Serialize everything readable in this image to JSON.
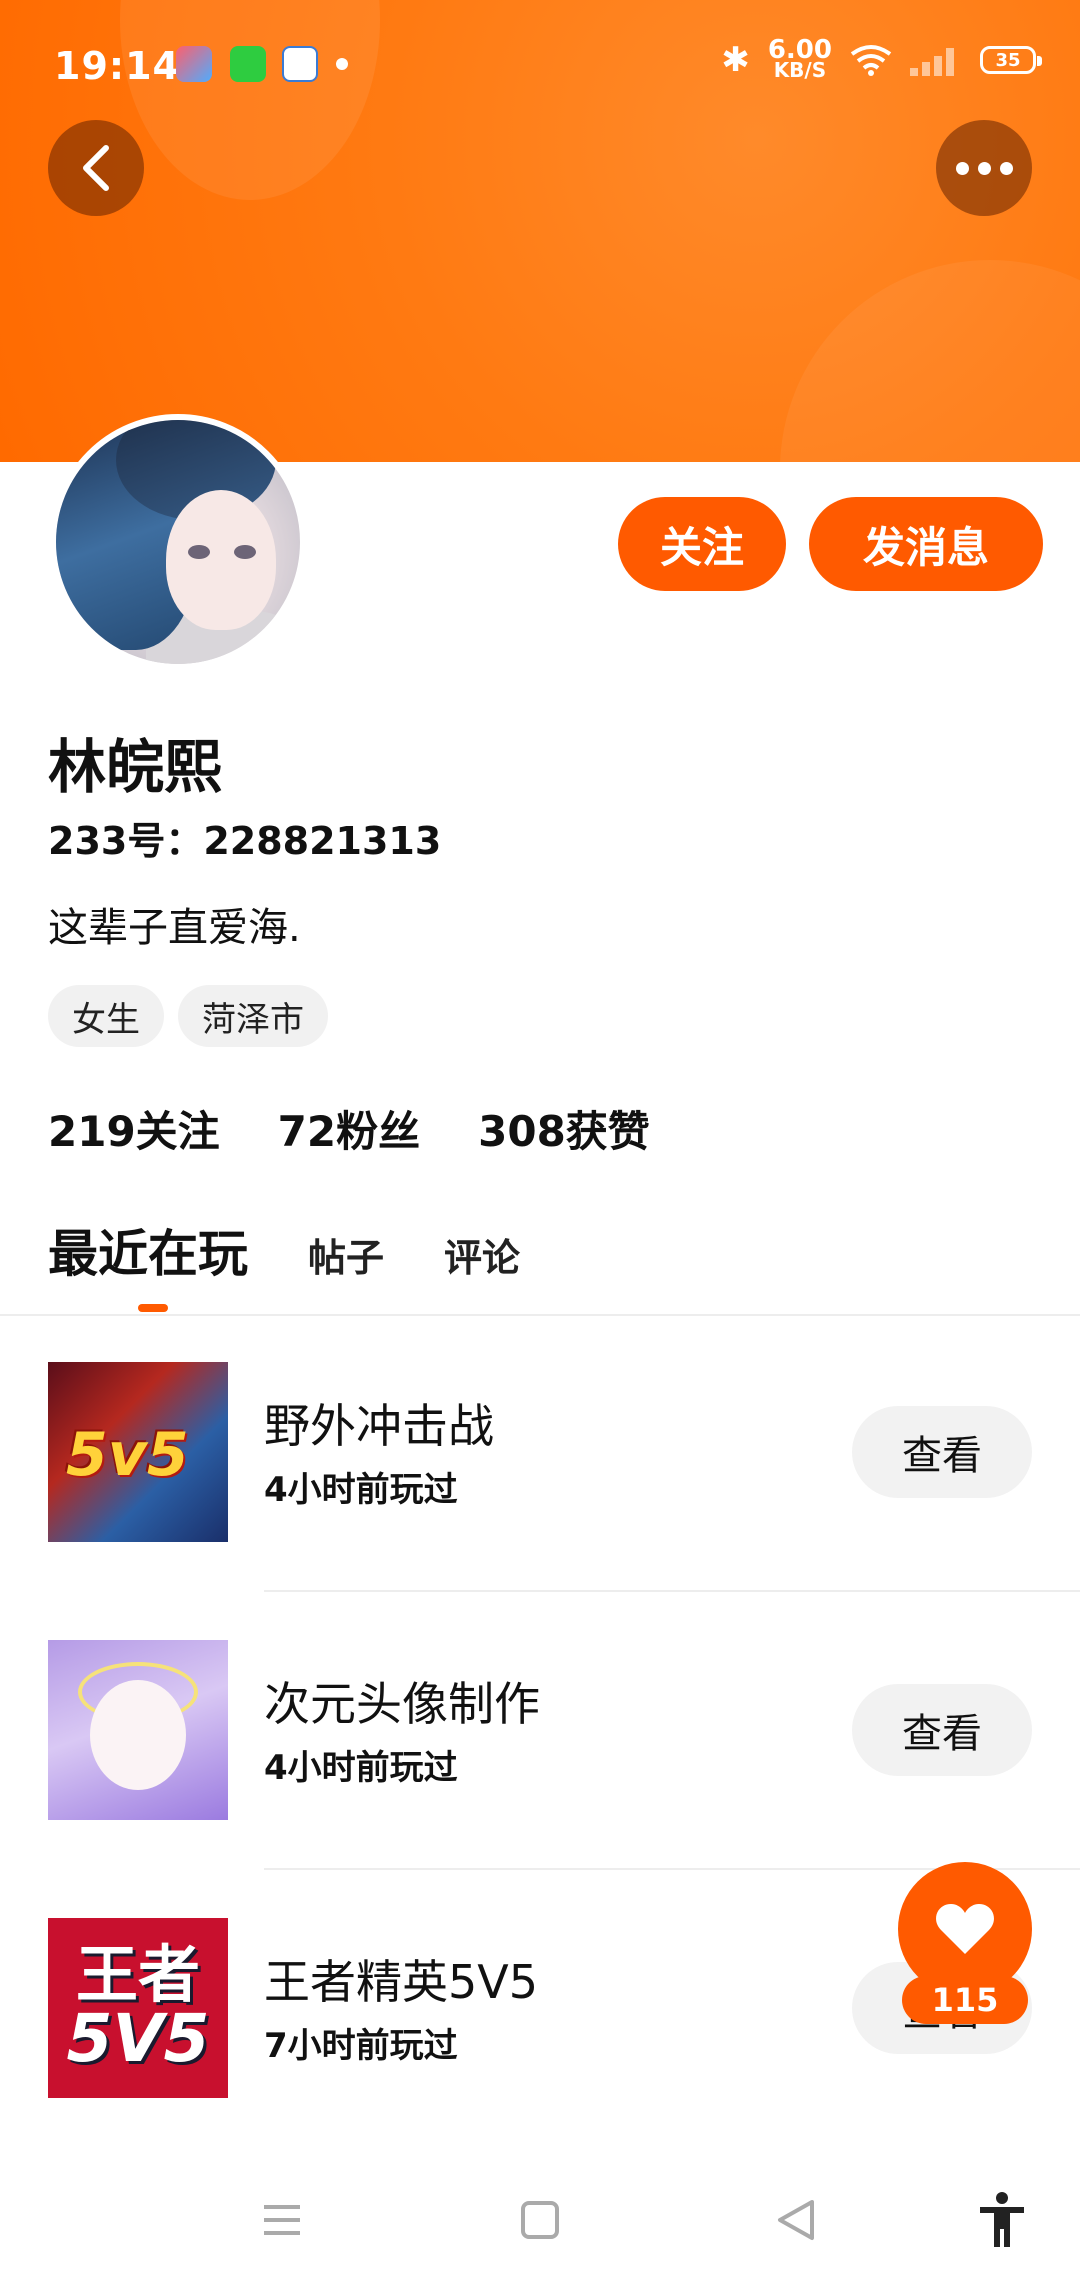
{
  "status_bar": {
    "time": "19:14",
    "network_speed_value": "6.00",
    "network_speed_unit": "KB/S",
    "battery": "35"
  },
  "profile": {
    "name": "林皖熙",
    "uid": "233号：228821313",
    "bio": "这辈子直爱海.",
    "tags": [
      "女生",
      "菏泽市"
    ],
    "stats": [
      {
        "text": "219关注"
      },
      {
        "text": "72粉丝"
      },
      {
        "text": "308获赞"
      }
    ],
    "follow_label": "关注",
    "message_label": "发消息"
  },
  "tabs": [
    {
      "label": "最近在玩",
      "active": true
    },
    {
      "label": "帖子",
      "active": false
    },
    {
      "label": "评论",
      "active": false
    }
  ],
  "games": [
    {
      "title": "野外冲击战",
      "time": "4小时前玩过",
      "button": "查看",
      "thumb_text": "5v5"
    },
    {
      "title": "次元头像制作",
      "time": "4小时前玩过",
      "button": "查看"
    },
    {
      "title": "王者精英5V5",
      "time": "7小时前玩过",
      "button": "查看",
      "thumb_text_1": "王者",
      "thumb_text_2": "5V5"
    }
  ],
  "like": {
    "count": "115"
  },
  "icons": {
    "back": "chevron-left-icon",
    "more": "more-dots-icon",
    "like": "heart-icon",
    "nav": [
      "menu-icon",
      "home-square-icon",
      "back-triangle-icon",
      "accessibility-icon"
    ]
  },
  "colors": {
    "accent": "#ff5a00",
    "banner": "#ff7a12"
  }
}
